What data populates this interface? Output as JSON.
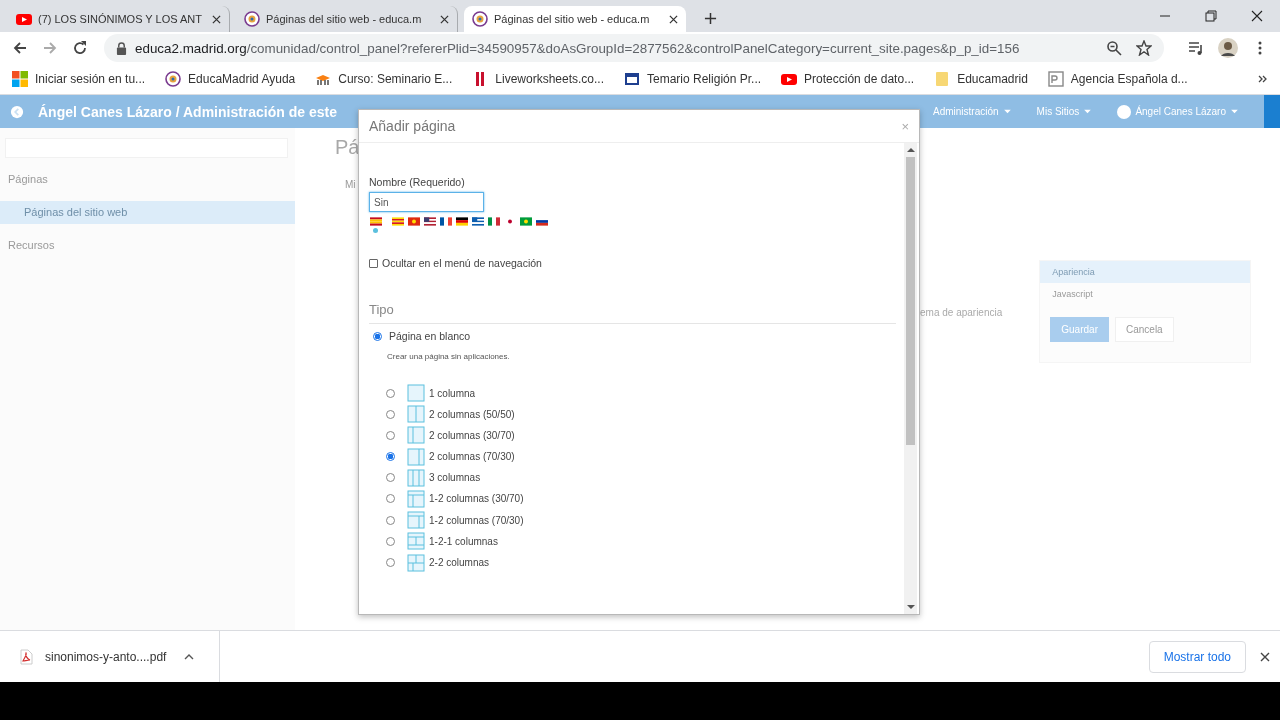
{
  "browser": {
    "tabs": [
      {
        "title": "(7) LOS SINÓNIMOS Y LOS ANT",
        "selected": false
      },
      {
        "title": "Páginas del sitio web - educa.m",
        "selected": false
      },
      {
        "title": "Páginas del sitio web - educa.m",
        "selected": true
      }
    ],
    "url": {
      "host": "educa2.madrid.org",
      "path": "/comunidad/control_panel?refererPlid=34590957&doAsGroupId=2877562&controlPanelCategory=current_site.pages&p_p_id=156"
    },
    "bookmarks": [
      {
        "label": "Iniciar sesión en tu..."
      },
      {
        "label": "EducaMadrid Ayuda"
      },
      {
        "label": "Curso: Seminario E..."
      },
      {
        "label": "Liveworksheets.co..."
      },
      {
        "label": "Temario Religión Pr..."
      },
      {
        "label": "Protección de dato..."
      },
      {
        "label": "Educamadrid"
      },
      {
        "label": "Agencia Española d..."
      }
    ]
  },
  "page": {
    "header": {
      "title": "Ángel Canes Lázaro / Administración de este",
      "menu": [
        "Administración",
        "Mis Sitios",
        "Ángel Canes Lázaro"
      ]
    },
    "sidebar": {
      "items": [
        {
          "label": "Páginas",
          "selected": false
        },
        {
          "label": "Páginas del sitio web",
          "selected": true
        },
        {
          "label": "Recursos",
          "selected": false
        }
      ]
    },
    "main": {
      "heading": "Pá",
      "tab": "Mi",
      "hint": "ema de apariencia",
      "panel": {
        "tabs": [
          {
            "label": "Apariencia",
            "selected": true
          },
          {
            "label": "Javascript",
            "selected": false
          }
        ],
        "buttons": [
          {
            "label": "Guardar",
            "kind": "primary"
          },
          {
            "label": "Cancela",
            "kind": "secondary"
          }
        ]
      }
    }
  },
  "dialog": {
    "title": "Añadir página",
    "close": "×",
    "name_label": "Nombre (Requerido)",
    "name_value": "Sin",
    "languages": [
      {
        "kind": "es",
        "selected": true
      },
      {
        "kind": "ca",
        "selected": false
      },
      {
        "kind": "zh",
        "selected": false
      },
      {
        "kind": "us",
        "selected": false
      },
      {
        "kind": "fr",
        "selected": false
      },
      {
        "kind": "de",
        "selected": false
      },
      {
        "kind": "gr",
        "selected": false
      },
      {
        "kind": "it",
        "selected": false
      },
      {
        "kind": "jp",
        "selected": false
      },
      {
        "kind": "br",
        "selected": false
      },
      {
        "kind": "ru",
        "selected": false
      }
    ],
    "hide_in_nav": {
      "label": "Ocultar en el menú de navegación",
      "checked": false
    },
    "type_heading": "Tipo",
    "type": {
      "label": "Página en blanco",
      "selected": true,
      "description": "Crear una página sin aplicaciones.",
      "layouts": [
        {
          "label": "1 columna",
          "kind": "single",
          "selected": false
        },
        {
          "label": "2 columnas (50/50)",
          "kind": "halves",
          "selected": false
        },
        {
          "label": "2 columnas (30/70)",
          "kind": "narrowleft",
          "selected": false
        },
        {
          "label": "2 columnas (70/30)",
          "kind": "narrowright",
          "selected": true
        },
        {
          "label": "3 columnas",
          "kind": "thirds",
          "selected": false
        },
        {
          "label": "1-2 columnas (30/70)",
          "kind": "topleft",
          "selected": false
        },
        {
          "label": "1-2 columnas (70/30)",
          "kind": "topright",
          "selected": false
        },
        {
          "label": "1-2-1 columnas",
          "kind": "sandwich",
          "selected": false
        },
        {
          "label": "2-2 columnas",
          "kind": "quads",
          "selected": false
        }
      ]
    }
  },
  "downloads": {
    "file": "sinonimos-y-anto....pdf",
    "button": "Mostrar todo"
  }
}
